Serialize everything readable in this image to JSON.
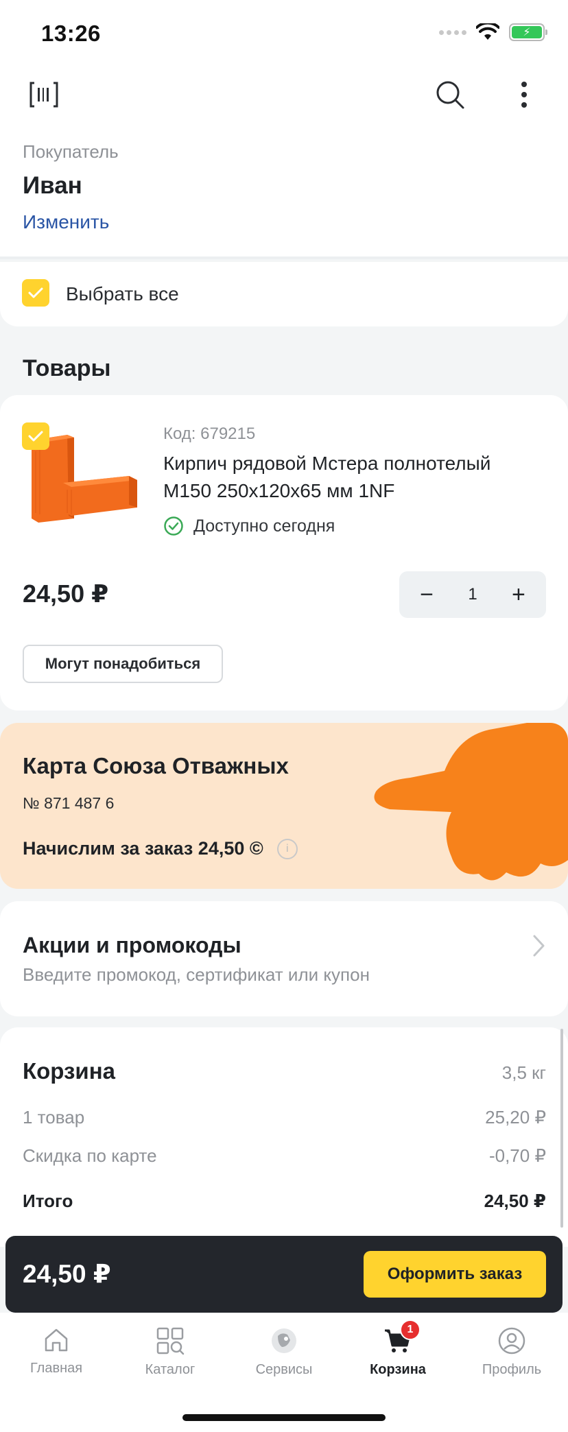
{
  "status": {
    "time": "13:26"
  },
  "buyer": {
    "label": "Покупатель",
    "name": "Иван",
    "change": "Изменить"
  },
  "select_all": {
    "label": "Выбрать все",
    "checked": true
  },
  "products_section": {
    "title": "Товары"
  },
  "product": {
    "code": "Код: 679215",
    "name": "Кирпич рядовой Мстера полнотелый М150 250x120x65 мм 1NF",
    "availability": "Доступно сегодня",
    "price": "24,50 ₽",
    "quantity": "1",
    "maybe_needed": "Могут понадобиться",
    "checked": true
  },
  "loyalty": {
    "title": "Карта Союза Отважных",
    "number": "№ 871 487 6",
    "points": "Начислим за заказ 24,50 ©"
  },
  "promo": {
    "title": "Акции и промокоды",
    "subtitle": "Введите промокод, сертификат или купон"
  },
  "cart": {
    "title": "Корзина",
    "weight": "3,5 кг",
    "rows": [
      {
        "label": "1 товар",
        "value": "25,20 ₽"
      },
      {
        "label": "Скидка по карте",
        "value": "-0,70 ₽"
      }
    ],
    "total_label": "Итого",
    "total_value": "24,50 ₽"
  },
  "checkout": {
    "price": "24,50 ₽",
    "button": "Оформить заказ"
  },
  "tabs": [
    {
      "label": "Главная",
      "icon": "home-icon"
    },
    {
      "label": "Каталог",
      "icon": "catalog-icon"
    },
    {
      "label": "Сервисы",
      "icon": "services-icon"
    },
    {
      "label": "Корзина",
      "icon": "cart-icon",
      "badge": "1",
      "active": true
    },
    {
      "label": "Профиль",
      "icon": "profile-icon"
    }
  ],
  "colors": {
    "accent": "#ffd32e",
    "brand_orange": "#f7821b",
    "link": "#2a55a5",
    "loyalty_bg": "#fde5cc"
  }
}
